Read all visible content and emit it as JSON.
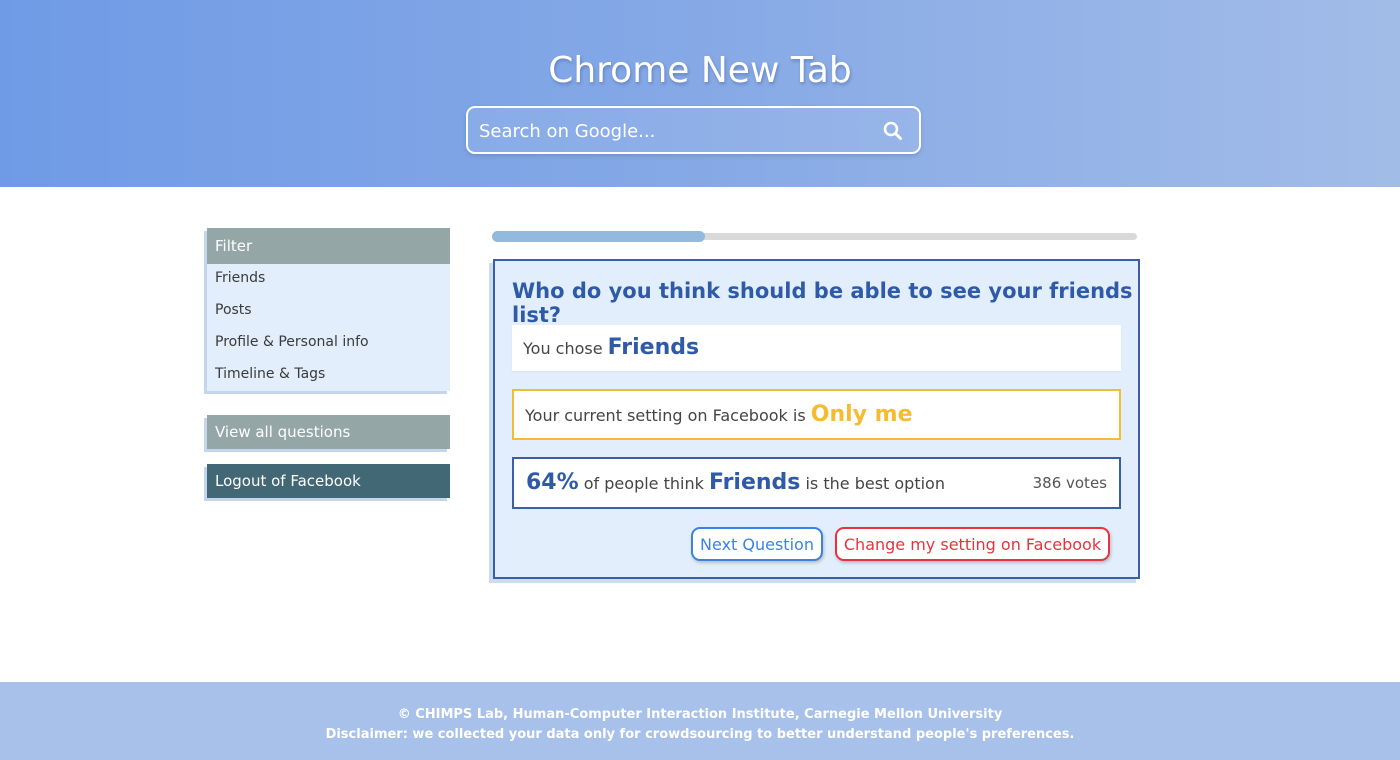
{
  "header": {
    "title": "Chrome New Tab",
    "search_placeholder": "Search on Google..."
  },
  "sidebar": {
    "filter_title": "Filter",
    "filter_items": [
      {
        "label": "Friends"
      },
      {
        "label": "Posts"
      },
      {
        "label": "Profile & Personal info"
      },
      {
        "label": "Timeline & Tags"
      }
    ],
    "view_all_label": "View all questions",
    "logout_label": "Logout of Facebook"
  },
  "progress": {
    "fraction": 0.33
  },
  "question_card": {
    "question": "Who do you think should be able to see your friends list?",
    "choice_prefix": "You chose",
    "choice_value": "Friends",
    "current_prefix": "Your current setting on Facebook is",
    "current_value": "Only me",
    "stats_percent": "64%",
    "stats_middle": "of people think",
    "stats_option": "Friends",
    "stats_suffix": "is the best option",
    "stats_votes": "386 votes",
    "next_label": "Next Question",
    "change_label": "Change my setting on Facebook"
  },
  "footer": {
    "line1": "© CHIMPS Lab, Human-Computer Interaction Institute, Carnegie Mellon University",
    "line2": "Disclaimer: we collected your data only for crowdsourcing to better understand people's preferences."
  },
  "colors": {
    "header_gradient_start": "#6f9be6",
    "header_gradient_end": "#a2bce8",
    "primary_blue": "#2f5aa8",
    "current_setting_yellow": "#f5bc33",
    "next_button_blue": "#3b82e6",
    "change_button_red": "#e8333f",
    "sidebar_gray": "#95a6a6",
    "logout_teal": "#426775",
    "card_bg": "#e2eefb",
    "progress_fill": "#93badd"
  },
  "icons": {
    "search": "search-icon"
  }
}
